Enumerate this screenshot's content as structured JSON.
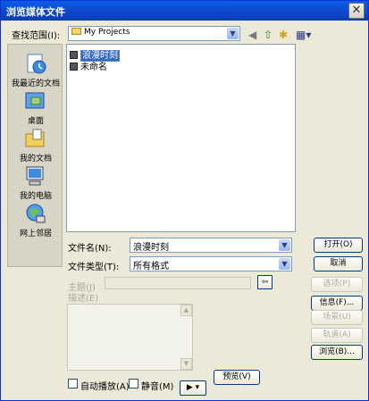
{
  "window": {
    "title": "浏览媒体文件"
  },
  "lookin": {
    "label": "查找范围(I):",
    "value": "My Projects"
  },
  "toolbar_icons": [
    "back-icon",
    "up-folder-icon",
    "new-folder-icon",
    "view-menu-icon"
  ],
  "places": [
    {
      "label": "我最近的文档",
      "icon": "recent-documents-icon"
    },
    {
      "label": "桌面",
      "icon": "desktop-icon"
    },
    {
      "label": "我的文档",
      "icon": "my-documents-icon"
    },
    {
      "label": "我的电脑",
      "icon": "my-computer-icon"
    },
    {
      "label": "网上邻居",
      "icon": "network-places-icon"
    }
  ],
  "files": [
    {
      "name": "浪漫时刻",
      "selected": true
    },
    {
      "name": "未命名",
      "selected": false
    }
  ],
  "filename": {
    "label": "文件名(N):",
    "value": "浪漫时刻"
  },
  "filetype": {
    "label": "文件类型(T):",
    "value": "所有格式"
  },
  "buttons": {
    "open": "打开(O)",
    "cancel": "取消",
    "options": "选项(P)",
    "info": "信息(F)...",
    "scene": "场景(U)",
    "track": "轨道(A)",
    "browse": "浏览(B)...",
    "preview": "预览(V)"
  },
  "meta": {
    "subject_label": "主题(J)",
    "description_label": "描述(E)"
  },
  "options": {
    "autoplay": "自动播放(A)",
    "mute": "静音(M)"
  }
}
